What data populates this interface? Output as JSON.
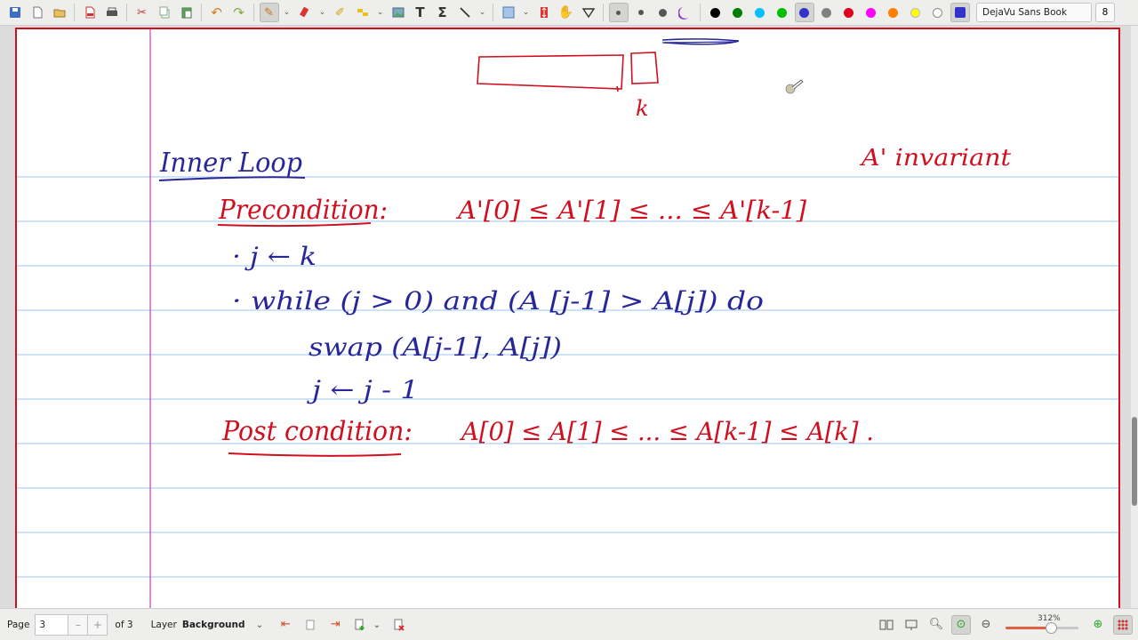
{
  "toolbar": {
    "font_name": "DejaVu Sans Book",
    "font_size": "8",
    "colors": [
      "#000000",
      "#008000",
      "#00c0ff",
      "#00c000",
      "#3333cc",
      "#808080",
      "#e00020",
      "#ff00ff",
      "#ff8000",
      "#ffff00",
      "#ffffff"
    ],
    "active_color": "#3333cc",
    "pen_color_square": "#3333cc"
  },
  "statusbar": {
    "page_label": "Page",
    "page_value": "3",
    "page_of": "of 3",
    "layer_label": "Layer",
    "layer_value": "Background",
    "zoom_level": "312%",
    "zoom_fraction": 0.62
  },
  "notes": {
    "k_label": "k",
    "heading": "Inner Loop",
    "invariant_label": "A' invariant",
    "precondition_label": "Precondition:",
    "precondition_expr": "A'[0] ≤ A'[1] ≤ ... ≤ A'[k-1]",
    "line1": "· j ← k",
    "line2": "· while (j > 0) and (A [j-1] > A[j]) do",
    "line3": "swap (A[j-1], A[j])",
    "line4": "j ← j - 1",
    "postcondition_label": "Post condition:",
    "postcondition_expr": "A[0] ≤ A[1] ≤ ... ≤ A[k-1] ≤ A[k] ."
  },
  "colors": {
    "ink_blue": "#27279a",
    "ink_red": "#d01020",
    "ruled_line": "#9ec8ee",
    "margin_line": "#c040c0"
  }
}
